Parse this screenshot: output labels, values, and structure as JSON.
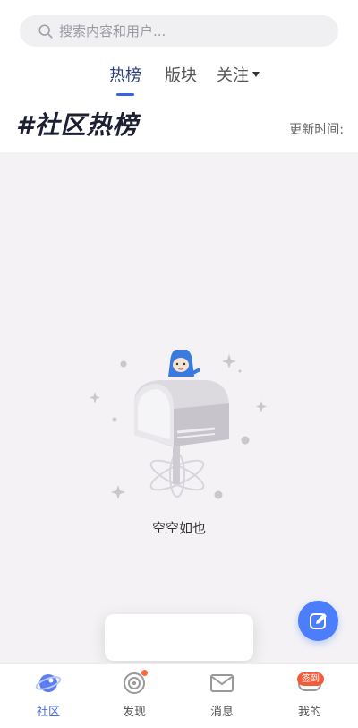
{
  "search": {
    "placeholder": "搜索内容和用户..."
  },
  "tabs": [
    {
      "label": "热榜",
      "active": true
    },
    {
      "label": "版块",
      "active": false
    },
    {
      "label": "关注",
      "active": false
    }
  ],
  "section": {
    "title": "#社区热榜",
    "update_time": "更新时间:"
  },
  "empty": {
    "text": "空空如也"
  },
  "tabbar": {
    "items": [
      {
        "label": "社区",
        "icon": "planet-icon",
        "active": true
      },
      {
        "label": "发现",
        "icon": "target-icon",
        "active": false
      },
      {
        "label": "消息",
        "icon": "mail-icon",
        "active": false
      },
      {
        "label": "我的",
        "icon": "gamepad-icon",
        "active": false
      }
    ],
    "checkin_badge": "签到"
  },
  "colors": {
    "accent": "#4c7dfa",
    "content_bg": "#f4f2f5",
    "badge": "#f25c3b"
  }
}
